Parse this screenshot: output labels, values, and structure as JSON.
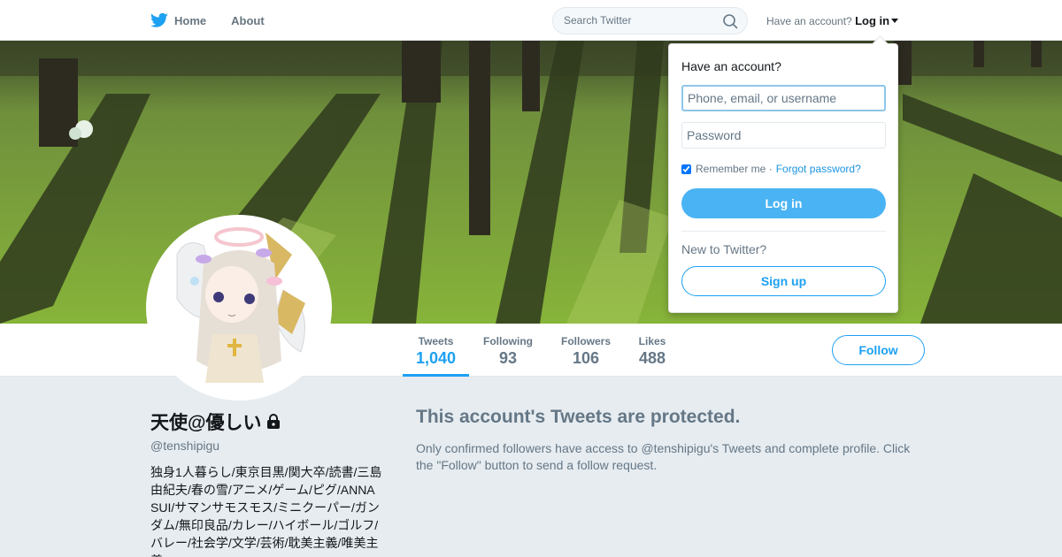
{
  "nav": {
    "home_label": "Home",
    "about_label": "About",
    "search_placeholder": "Search Twitter",
    "account_prompt": "Have an account?",
    "login_label": "Log in"
  },
  "profile": {
    "display_name": "天使@優しい",
    "handle": "@tenshipigu",
    "bio": "独身1人暮らし/東京目黒/関大卒/読書/三島由紀夫/春の雪/アニメ/ゲーム/ピグ/ANNA SUI/サマンサモスモス/ミニクーパー/ガンダム/無印良品/カレー/ハイボール/ゴルフ/バレー/社会学/文学/芸術/耽美主義/唯美主義"
  },
  "stats": [
    {
      "label": "Tweets",
      "value": "1,040"
    },
    {
      "label": "Following",
      "value": "93"
    },
    {
      "label": "Followers",
      "value": "106"
    },
    {
      "label": "Likes",
      "value": "488"
    }
  ],
  "follow_label": "Follow",
  "protected": {
    "title": "This account's Tweets are protected.",
    "body": "Only confirmed followers have access to @tenshipigu's Tweets and complete profile. Click the \"Follow\" button to send a follow request."
  },
  "login_dropdown": {
    "title": "Have an account?",
    "username_placeholder": "Phone, email, or username",
    "password_placeholder": "Password",
    "remember_label": "Remember me",
    "separator": "·",
    "forgot_label": "Forgot password?",
    "login_button": "Log in",
    "new_label": "New to Twitter?",
    "signup_button": "Sign up"
  },
  "colors": {
    "accent": "#1da1f2",
    "login_button": "#4ab3f4",
    "background": "#e6ecf0"
  }
}
